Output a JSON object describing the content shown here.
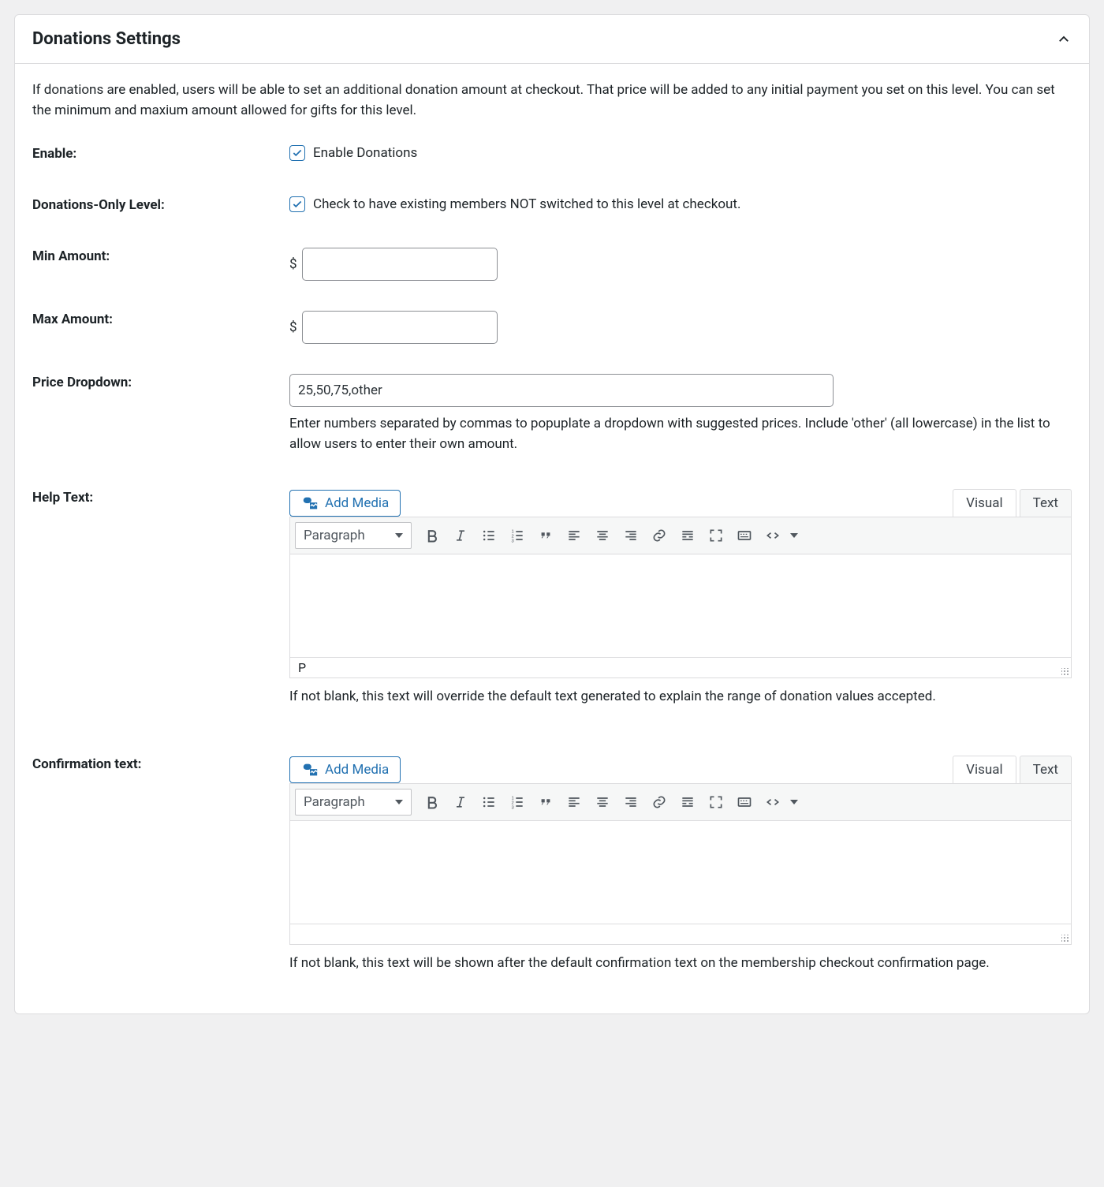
{
  "panel": {
    "title": "Donations Settings",
    "intro": "If donations are enabled, users will be able to set an additional donation amount at checkout. That price will be added to any initial payment you set on this level. You can set the minimum and maxium amount allowed for gifts for this level."
  },
  "fields": {
    "enable": {
      "label": "Enable:",
      "text": "Enable Donations"
    },
    "donations_only": {
      "label": "Donations-Only Level:",
      "text": "Check to have existing members NOT switched to this level at checkout."
    },
    "min_amount": {
      "label": "Min Amount:",
      "currency": "$",
      "value": ""
    },
    "max_amount": {
      "label": "Max Amount:",
      "currency": "$",
      "value": ""
    },
    "price_dropdown": {
      "label": "Price Dropdown:",
      "value": "25,50,75,other",
      "help": "Enter numbers separated by commas to popuplate a dropdown with suggested prices. Include 'other' (all lowercase) in the list to allow users to enter their own amount."
    },
    "help_text": {
      "label": "Help Text:",
      "after": "If not blank, this text will override the default text generated to explain the range of donation values accepted."
    },
    "confirmation_text": {
      "label": "Confirmation text:",
      "after": "If not blank, this text will be shown after the default confirmation text on the membership checkout confirmation page."
    }
  },
  "editor": {
    "add_media": "Add Media",
    "tabs": {
      "visual": "Visual",
      "text": "Text"
    },
    "format": "Paragraph",
    "status_p": "P"
  }
}
